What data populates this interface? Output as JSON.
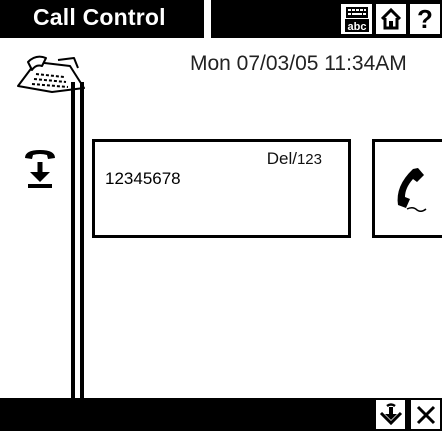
{
  "window": {
    "title": "Call Control"
  },
  "status": {
    "datetime": "Mon 07/03/05 11:34AM"
  },
  "call": {
    "line_prefix": "Del/",
    "line_number": "123",
    "number": "12345678"
  },
  "icons": {
    "device": "phone-fax-icon",
    "keyboard": "keyboard-abc-icon",
    "home": "home-icon",
    "help": "help-icon",
    "pickup": "handset-download-icon",
    "call": "handset-icon",
    "acknowledge": "hold-arrow-icon",
    "close": "close-icon"
  },
  "help_glyph": "?"
}
